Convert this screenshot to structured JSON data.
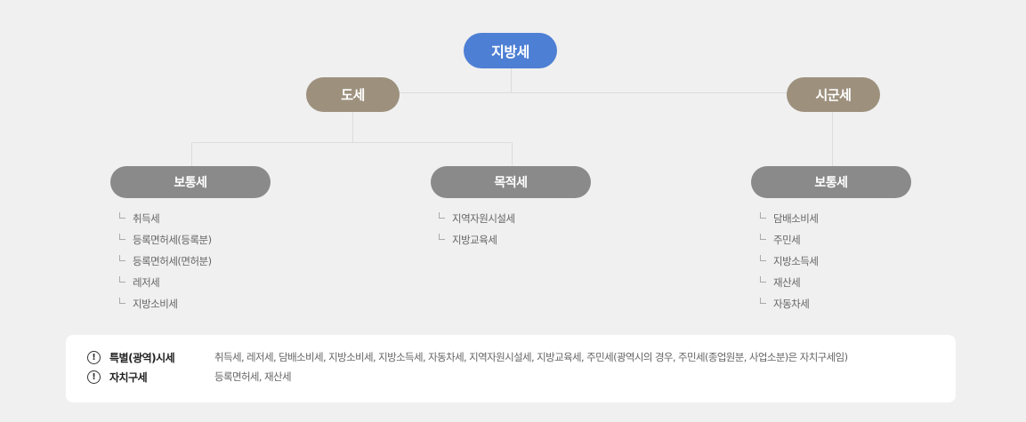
{
  "root": {
    "label": "지방세"
  },
  "provincial": {
    "label": "도세",
    "ordinary": {
      "label": "보통세",
      "items": [
        "취득세",
        "등록면허세(등록분)",
        "등록면허세(면허분)",
        "레저세",
        "지방소비세"
      ]
    },
    "purpose": {
      "label": "목적세",
      "items": [
        "지역자원시설세",
        "지방교육세"
      ]
    }
  },
  "municipal": {
    "label": "시군세",
    "ordinary": {
      "label": "보통세",
      "items": [
        "담배소비세",
        "주민세",
        "지방소득세",
        "재산세",
        "자동차세"
      ]
    }
  },
  "notes": [
    {
      "icon": "!",
      "label": "특별(광역)시세",
      "desc": "취득세, 레저세, 담배소비세, 지방소비세, 지방소득세, 자동차세, 지역자원시설세, 지방교육세, 주민세(광역시의 경우, 주민세(종업원분, 사업소분)은 자치구세임)"
    },
    {
      "icon": "!",
      "label": "자치구세",
      "desc": "등록면허세, 재산세"
    }
  ],
  "colors": {
    "root": "#4d7fd4",
    "level1": "#9d917e",
    "level2": "#8a8a8a",
    "background": "#f0f0f0"
  }
}
